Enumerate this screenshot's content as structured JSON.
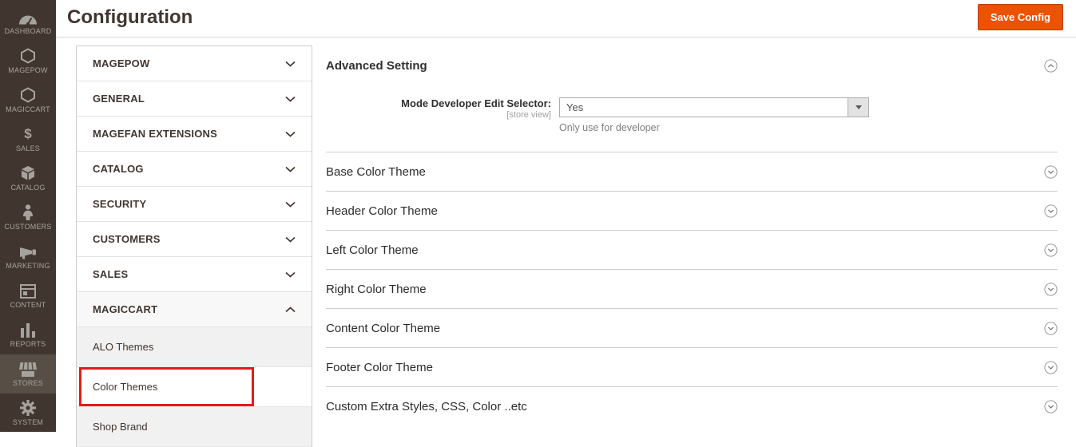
{
  "page_title": "Configuration",
  "toolbar": {
    "save_label": "Save Config"
  },
  "colors": {
    "accent": "#eb5202",
    "sidebar_bg": "#41362f",
    "sidebar_active_bg": "#574e46",
    "annotation_red": "#de1c1c"
  },
  "sidebar": {
    "items": [
      {
        "label": "DASHBOARD",
        "icon": "dashboard-icon",
        "active": false
      },
      {
        "label": "MAGEPOW",
        "icon": "hexagon-icon",
        "active": false
      },
      {
        "label": "MAGICCART",
        "icon": "hexagon-icon",
        "active": false
      },
      {
        "label": "SALES",
        "icon": "dollar-icon",
        "active": false
      },
      {
        "label": "CATALOG",
        "icon": "box-icon",
        "active": false
      },
      {
        "label": "CUSTOMERS",
        "icon": "person-icon",
        "active": false
      },
      {
        "label": "MARKETING",
        "icon": "megaphone-icon",
        "active": false
      },
      {
        "label": "CONTENT",
        "icon": "window-icon",
        "active": false
      },
      {
        "label": "REPORTS",
        "icon": "bar-chart-icon",
        "active": false
      },
      {
        "label": "STORES",
        "icon": "store-icon",
        "active": true
      },
      {
        "label": "SYSTEM",
        "icon": "gear-icon",
        "active": false
      }
    ]
  },
  "config_nav": {
    "sections": [
      {
        "label": "MAGEPOW",
        "state": "collapsed"
      },
      {
        "label": "GENERAL",
        "state": "collapsed"
      },
      {
        "label": "MAGEFAN EXTENSIONS",
        "state": "collapsed"
      },
      {
        "label": "CATALOG",
        "state": "collapsed"
      },
      {
        "label": "SECURITY",
        "state": "collapsed"
      },
      {
        "label": "CUSTOMERS",
        "state": "collapsed"
      },
      {
        "label": "SALES",
        "state": "collapsed"
      },
      {
        "label": "MAGICCART",
        "state": "expanded"
      }
    ],
    "subitems": [
      {
        "label": "ALO Themes",
        "selected": false,
        "annotated": false
      },
      {
        "label": "Color Themes",
        "selected": true,
        "annotated": true
      },
      {
        "label": "Shop Brand",
        "selected": false,
        "annotated": false
      }
    ]
  },
  "main": {
    "advanced": {
      "title": "Advanced Setting",
      "state": "expanded",
      "field_label": "Mode Developer Edit Selector:",
      "scope_hint": "[store view]",
      "select_value": "Yes",
      "comment": "Only use for developer"
    },
    "collapsed_sections": [
      "Base Color Theme",
      "Header Color Theme",
      "Left Color Theme",
      "Right Color Theme",
      "Content Color Theme",
      "Footer Color Theme",
      "Custom Extra Styles, CSS, Color ..etc"
    ]
  }
}
